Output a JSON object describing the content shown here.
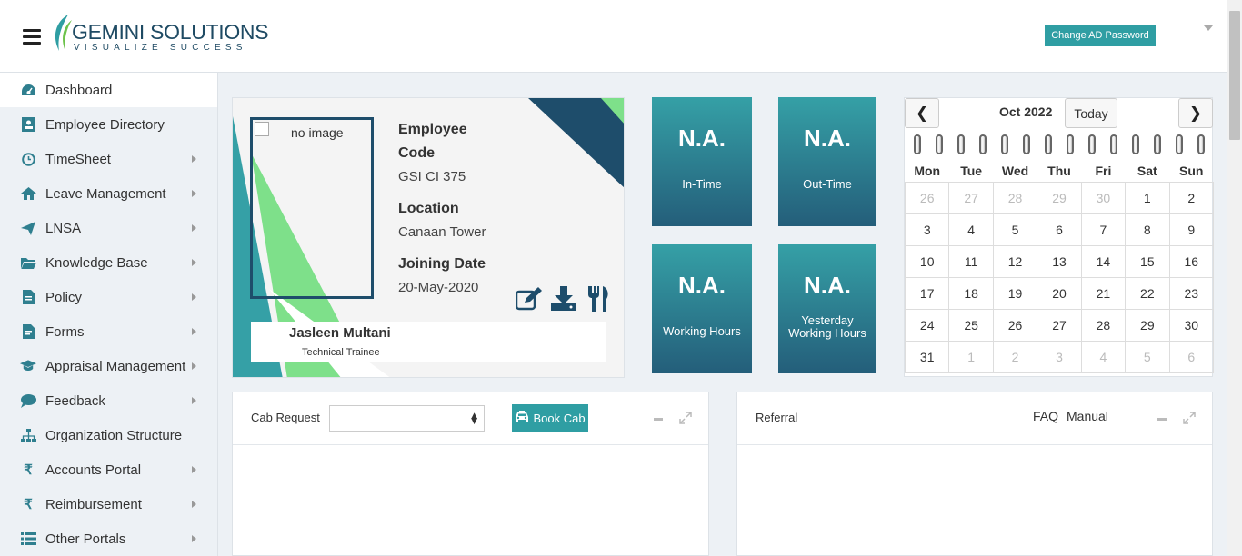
{
  "header": {
    "brand_name": "GEMINI SOLUTIONS",
    "brand_tagline": "VISUALIZE SUCCESS",
    "change_password_label": "Change AD Password"
  },
  "sidebar": {
    "items": [
      {
        "label": "Dashboard",
        "icon": "dashboard-icon",
        "active": true
      },
      {
        "label": "Employee Directory",
        "icon": "id-card-icon"
      },
      {
        "label": "TimeSheet",
        "icon": "clock-icon"
      },
      {
        "label": "Leave Management",
        "icon": "home-icon"
      },
      {
        "label": "LNSA",
        "icon": "send-icon"
      },
      {
        "label": "Knowledge Base",
        "icon": "folder-icon"
      },
      {
        "label": "Policy",
        "icon": "document-icon"
      },
      {
        "label": "Forms",
        "icon": "form-icon"
      },
      {
        "label": "Appraisal Management",
        "icon": "graduation-cap-icon"
      },
      {
        "label": "Feedback",
        "icon": "chat-icon"
      },
      {
        "label": "Organization Structure",
        "icon": "sitemap-icon"
      },
      {
        "label": "Accounts Portal",
        "icon": "rupee-icon"
      },
      {
        "label": "Reimbursement",
        "icon": "rupee-icon"
      },
      {
        "label": "Other Portals",
        "icon": "list-icon"
      }
    ]
  },
  "profile": {
    "photo_alt": "no image",
    "employee_code_label": "Employee",
    "employee_code_label2": "Code",
    "employee_code": "GSI CI 375",
    "location_label": "Location",
    "location": "Canaan Tower",
    "joining_label": "Joining Date",
    "joining_date": "20-May-2020",
    "name": "Jasleen Multani",
    "designation": "Technical Trainee"
  },
  "stats": {
    "in_time": {
      "value": "N.A.",
      "label": "In-Time"
    },
    "out_time": {
      "value": "N.A.",
      "label": "Out-Time"
    },
    "working_hours": {
      "value": "N.A.",
      "label": "Working Hours"
    },
    "yesterday_hours": {
      "value": "N.A.",
      "label_line1": "Yesterday",
      "label_line2": "Working Hours"
    }
  },
  "calendar": {
    "prev": "❮",
    "next": "❯",
    "title": "Oct 2022",
    "today_label": "Today",
    "weekdays": [
      "Mon",
      "Tue",
      "Wed",
      "Thu",
      "Fri",
      "Sat",
      "Sun"
    ],
    "weeks": [
      [
        "26",
        "27",
        "28",
        "29",
        "30",
        "1",
        "2"
      ],
      [
        "3",
        "4",
        "5",
        "6",
        "7",
        "8",
        "9"
      ],
      [
        "10",
        "11",
        "12",
        "13",
        "14",
        "15",
        "16"
      ],
      [
        "17",
        "18",
        "19",
        "20",
        "21",
        "22",
        "23"
      ],
      [
        "24",
        "25",
        "26",
        "27",
        "28",
        "29",
        "30"
      ],
      [
        "31",
        "1",
        "2",
        "3",
        "4",
        "5",
        "6"
      ]
    ]
  },
  "cab_panel": {
    "title": "Cab Request",
    "select_value": "",
    "book_label": "Book Cab"
  },
  "referral_panel": {
    "title": "Referral",
    "faq_label": "FAQ",
    "manual_label": "Manual"
  }
}
